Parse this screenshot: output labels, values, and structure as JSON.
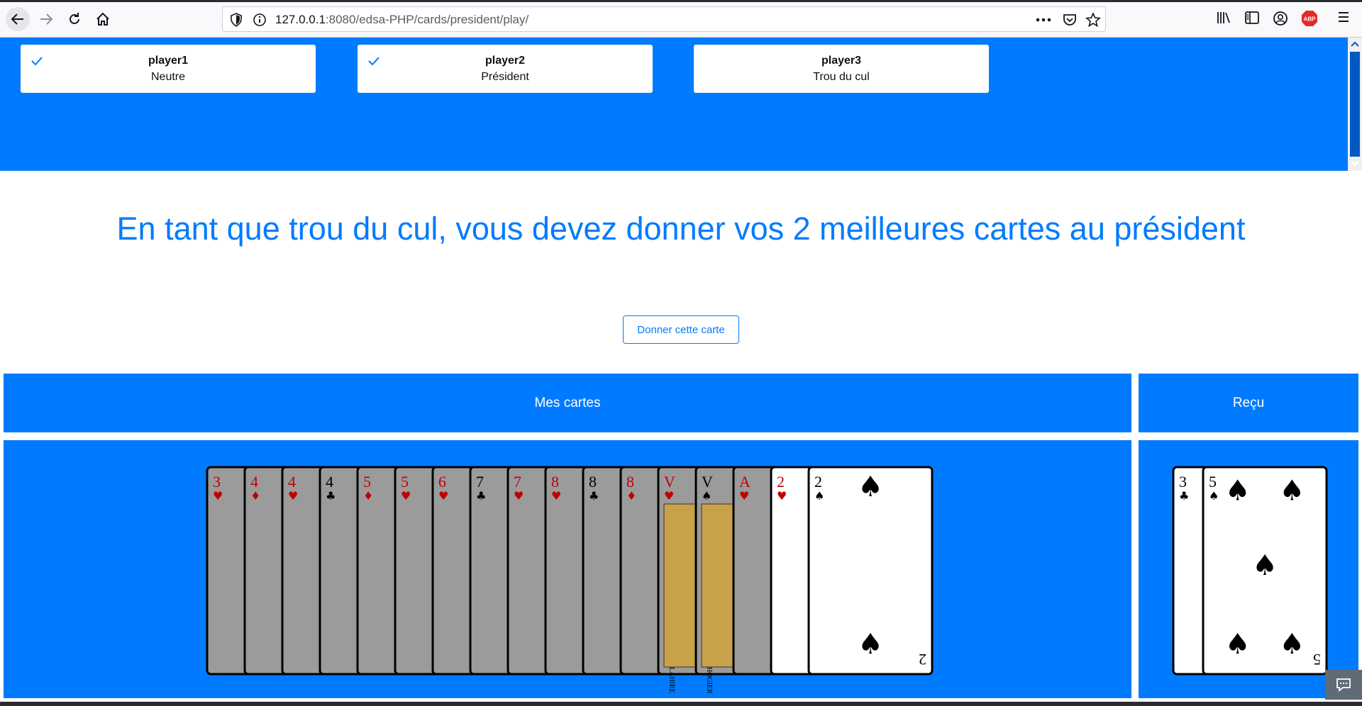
{
  "browser": {
    "url_host": "127.0.0.1",
    "url_path": ":8080/edsa-PHP/cards/president/play/",
    "icons": [
      "back-arrow-icon",
      "forward-arrow-icon",
      "reload-icon",
      "home-icon",
      "shield-icon",
      "info-icon",
      "more-dots-icon",
      "pocket-icon",
      "bookmark-star-icon",
      "library-icon",
      "sidebar-icon",
      "account-icon",
      "adblock-icon",
      "hamburger-menu-icon"
    ],
    "adblock_label": "ABP"
  },
  "players": [
    {
      "name": "player1",
      "role": "Neutre",
      "checked": true
    },
    {
      "name": "player2",
      "role": "Président",
      "checked": true
    },
    {
      "name": "player3",
      "role": "Trou du cul",
      "checked": false
    }
  ],
  "instruction": "En tant que trou du cul, vous devez donner vos 2 meilleures cartes au président",
  "give_button": "Donner cette carte",
  "my_cards": {
    "title": "Mes cartes",
    "cards": [
      {
        "rank": "3",
        "suit": "hearts",
        "state": "greyed"
      },
      {
        "rank": "4",
        "suit": "diamonds",
        "state": "greyed"
      },
      {
        "rank": "4",
        "suit": "hearts",
        "state": "greyed"
      },
      {
        "rank": "4",
        "suit": "clubs",
        "state": "greyed"
      },
      {
        "rank": "5",
        "suit": "diamonds",
        "state": "greyed"
      },
      {
        "rank": "5",
        "suit": "hearts",
        "state": "greyed"
      },
      {
        "rank": "6",
        "suit": "hearts",
        "state": "greyed"
      },
      {
        "rank": "7",
        "suit": "clubs",
        "state": "greyed"
      },
      {
        "rank": "7",
        "suit": "hearts",
        "state": "greyed"
      },
      {
        "rank": "8",
        "suit": "hearts",
        "state": "greyed"
      },
      {
        "rank": "8",
        "suit": "clubs",
        "state": "greyed"
      },
      {
        "rank": "8",
        "suit": "diamonds",
        "state": "greyed"
      },
      {
        "rank": "V",
        "suit": "hearts",
        "state": "greyed",
        "face_name": "LAHIRE"
      },
      {
        "rank": "V",
        "suit": "spades",
        "state": "greyed",
        "face_name": "HOGIER"
      },
      {
        "rank": "A",
        "suit": "hearts",
        "state": "greyed"
      },
      {
        "rank": "2",
        "suit": "hearts",
        "state": "selectable"
      },
      {
        "rank": "2",
        "suit": "spades",
        "state": "selectable"
      }
    ]
  },
  "received": {
    "title": "Reçu",
    "cards": [
      {
        "rank": "3",
        "suit": "clubs"
      },
      {
        "rank": "5",
        "suit": "spades"
      }
    ]
  },
  "colors": {
    "accent": "#007bff",
    "card_grey": "#9b9b9b",
    "card_red": "#c00000",
    "card_black": "#000000"
  }
}
